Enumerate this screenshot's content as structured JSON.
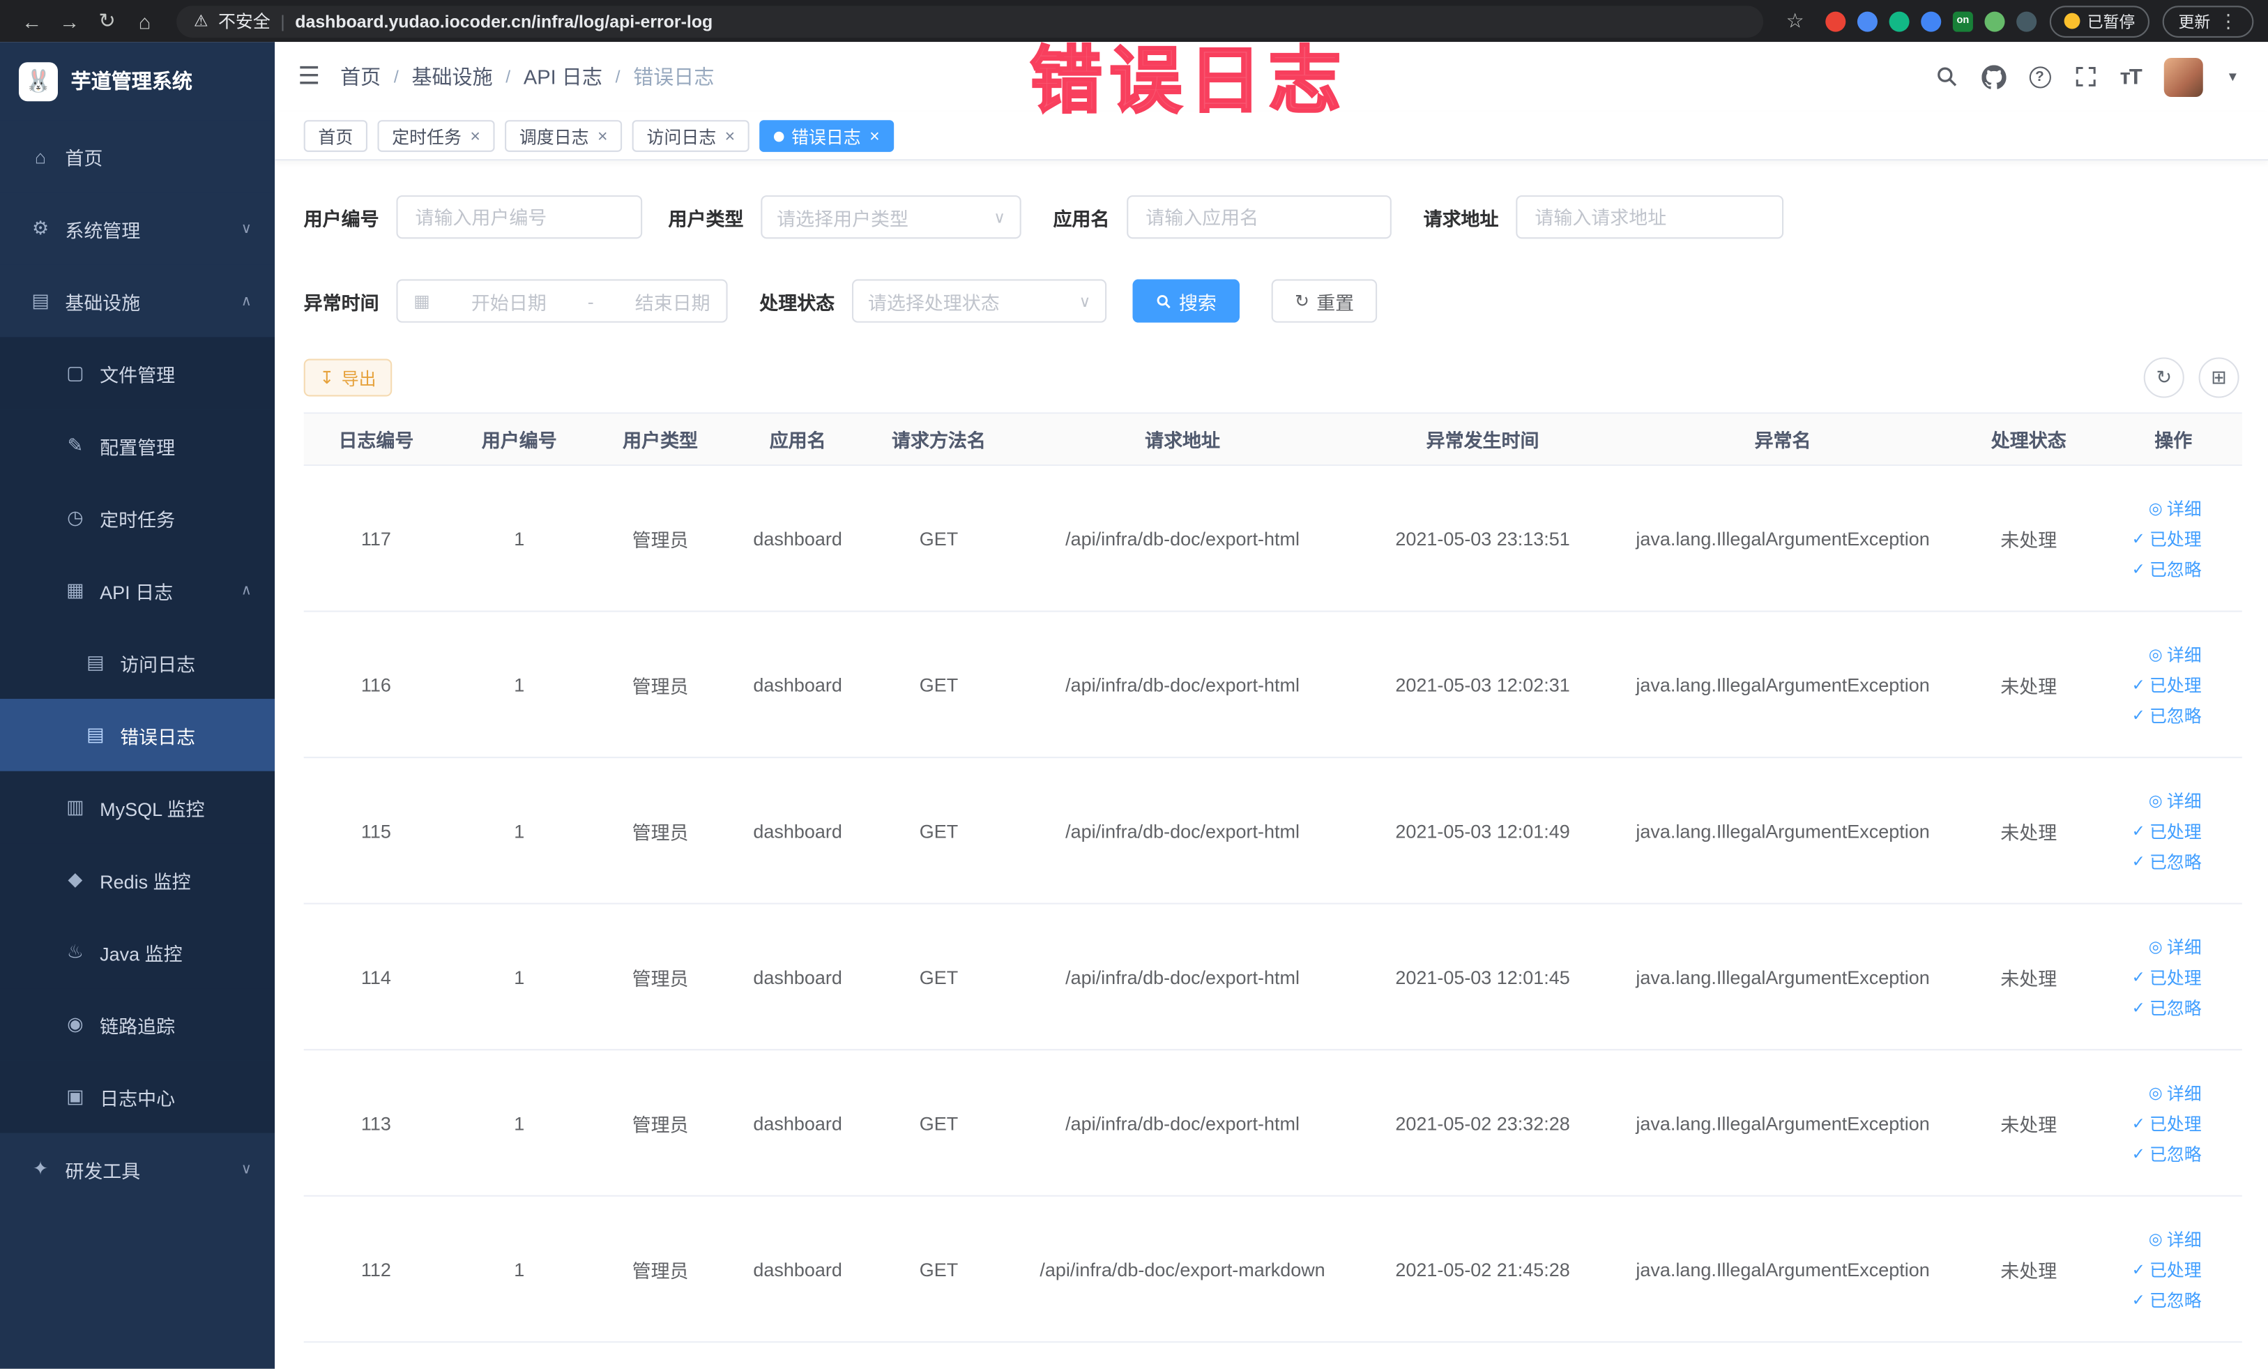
{
  "colors": {
    "accent_blue": "#409eff",
    "sidebar_bg": "#1f3350",
    "submenu_bg": "#182942",
    "active_item_bg": "#2f5288",
    "warning_orange": "#e6a23c",
    "watermark_pink": "#f83f5d",
    "chrome_bg": "#202124",
    "link_blue": "#409eff"
  },
  "watermark": {
    "text": "错误日志"
  },
  "browser": {
    "security_label": "不安全",
    "url": "dashboard.yudao.iocoder.cn/infra/log/api-error-log",
    "paused_label": "已暂停",
    "update_label": "更新",
    "extensions": [
      {
        "name": "extension-red-icon",
        "style": "background:#ea4335",
        "text": ""
      },
      {
        "name": "extension-blue-icon",
        "style": "background:#4c8bf5",
        "text": ""
      },
      {
        "name": "extension-green-icon",
        "style": "background:#12b886",
        "text": ""
      },
      {
        "name": "extension-grid-icon",
        "style": "background:#4285f4",
        "text": ""
      },
      {
        "name": "extension-on-icon",
        "style": "background:#188038; border-radius:3px",
        "text": "on"
      },
      {
        "name": "extension-leaf-icon",
        "style": "background:#66bb6a",
        "text": ""
      },
      {
        "name": "extension-paw-icon",
        "style": "background:#455a64",
        "text": ""
      }
    ]
  },
  "sidebar": {
    "logo_title": "芋道管理系统",
    "items": [
      {
        "label": "首页",
        "icon": "home-icon",
        "glyph": "⌂",
        "level": 1,
        "chev": ""
      },
      {
        "label": "系统管理",
        "icon": "system-manage-icon",
        "glyph": "⚙",
        "level": 1,
        "chev": "∨"
      },
      {
        "label": "基础设施",
        "icon": "infrastructure-icon",
        "glyph": "▤",
        "level": 1,
        "chev": "∧"
      },
      {
        "label": "文件管理",
        "icon": "file-manage-icon",
        "glyph": "▢",
        "level": 2,
        "chev": ""
      },
      {
        "label": "配置管理",
        "icon": "config-manage-icon",
        "glyph": "✎",
        "level": 2,
        "chev": ""
      },
      {
        "label": "定时任务",
        "icon": "scheduled-task-icon",
        "glyph": "◷",
        "level": 2,
        "chev": ""
      },
      {
        "label": "API 日志",
        "icon": "api-log-icon",
        "glyph": "▦",
        "level": 2,
        "chev": "∧"
      },
      {
        "label": "访问日志",
        "icon": "access-log-icon",
        "glyph": "▤",
        "level": 3,
        "chev": ""
      },
      {
        "label": "错误日志",
        "icon": "error-log-icon",
        "glyph": "▤",
        "level": 3,
        "chev": "",
        "active": true
      },
      {
        "label": "MySQL 监控",
        "icon": "mysql-monitor-icon",
        "glyph": "▥",
        "level": 2,
        "chev": ""
      },
      {
        "label": "Redis 监控",
        "icon": "redis-monitor-icon",
        "glyph": "◆",
        "level": 2,
        "chev": ""
      },
      {
        "label": "Java 监控",
        "icon": "java-monitor-icon",
        "glyph": "♨",
        "level": 2,
        "chev": ""
      },
      {
        "label": "链路追踪",
        "icon": "tracing-icon",
        "glyph": "◉",
        "level": 2,
        "chev": ""
      },
      {
        "label": "日志中心",
        "icon": "log-center-icon",
        "glyph": "▣",
        "level": 2,
        "chev": ""
      },
      {
        "label": "研发工具",
        "icon": "dev-tools-icon",
        "glyph": "✦",
        "level": 1,
        "chev": "∨"
      }
    ]
  },
  "header": {
    "breadcrumb": [
      "首页",
      "基础设施",
      "API 日志",
      "错误日志"
    ],
    "icons": [
      "search-icon",
      "github-icon",
      "help-icon",
      "fullscreen-icon",
      "font-size-icon",
      "avatar"
    ]
  },
  "tabs": [
    {
      "label": "首页",
      "closable": false,
      "active": false
    },
    {
      "label": "定时任务",
      "closable": true,
      "active": false
    },
    {
      "label": "调度日志",
      "closable": true,
      "active": false
    },
    {
      "label": "访问日志",
      "closable": true,
      "active": false
    },
    {
      "label": "错误日志",
      "closable": true,
      "active": true
    }
  ],
  "filters": {
    "user_id_label": "用户编号",
    "user_id_placeholder": "请输入用户编号",
    "user_type_label": "用户类型",
    "user_type_placeholder": "请选择用户类型",
    "app_name_label": "应用名",
    "app_name_placeholder": "请输入应用名",
    "request_url_label": "请求地址",
    "request_url_placeholder": "请输入请求地址",
    "exception_time_label": "异常时间",
    "date_start_placeholder": "开始日期",
    "date_separator": "-",
    "date_end_placeholder": "结束日期",
    "process_status_label": "处理状态",
    "process_status_placeholder": "请选择处理状态",
    "search_label": "搜索",
    "reset_label": "重置"
  },
  "toolbar": {
    "export_label": "导出"
  },
  "table": {
    "headers": [
      "日志编号",
      "用户编号",
      "用户类型",
      "应用名",
      "请求方法名",
      "请求地址",
      "异常发生时间",
      "异常名",
      "处理状态",
      "操作"
    ],
    "actions": [
      {
        "label": "详细",
        "icon": "eye-icon",
        "glyph": "◎"
      },
      {
        "label": "已处理",
        "icon": "check-icon",
        "glyph": "✓"
      },
      {
        "label": "已忽略",
        "icon": "check-icon",
        "glyph": "✓"
      }
    ],
    "rows": [
      {
        "id": 117,
        "user_id": 1,
        "user_type": "管理员",
        "app": "dashboard",
        "method": "GET",
        "url": "/api/infra/db-doc/export-html",
        "time": "2021-05-03 23:13:51",
        "exception": "java.lang.IllegalArgumentException",
        "status": "未处理"
      },
      {
        "id": 116,
        "user_id": 1,
        "user_type": "管理员",
        "app": "dashboard",
        "method": "GET",
        "url": "/api/infra/db-doc/export-html",
        "time": "2021-05-03 12:02:31",
        "exception": "java.lang.IllegalArgumentException",
        "status": "未处理"
      },
      {
        "id": 115,
        "user_id": 1,
        "user_type": "管理员",
        "app": "dashboard",
        "method": "GET",
        "url": "/api/infra/db-doc/export-html",
        "time": "2021-05-03 12:01:49",
        "exception": "java.lang.IllegalArgumentException",
        "status": "未处理"
      },
      {
        "id": 114,
        "user_id": 1,
        "user_type": "管理员",
        "app": "dashboard",
        "method": "GET",
        "url": "/api/infra/db-doc/export-html",
        "time": "2021-05-03 12:01:45",
        "exception": "java.lang.IllegalArgumentException",
        "status": "未处理"
      },
      {
        "id": 113,
        "user_id": 1,
        "user_type": "管理员",
        "app": "dashboard",
        "method": "GET",
        "url": "/api/infra/db-doc/export-html",
        "time": "2021-05-02 23:32:28",
        "exception": "java.lang.IllegalArgumentException",
        "status": "未处理"
      },
      {
        "id": 112,
        "user_id": 1,
        "user_type": "管理员",
        "app": "dashboard",
        "method": "GET",
        "url": "/api/infra/db-doc/export-markdown",
        "time": "2021-05-02 21:45:28",
        "exception": "java.lang.IllegalArgumentException",
        "status": "未处理"
      }
    ]
  }
}
